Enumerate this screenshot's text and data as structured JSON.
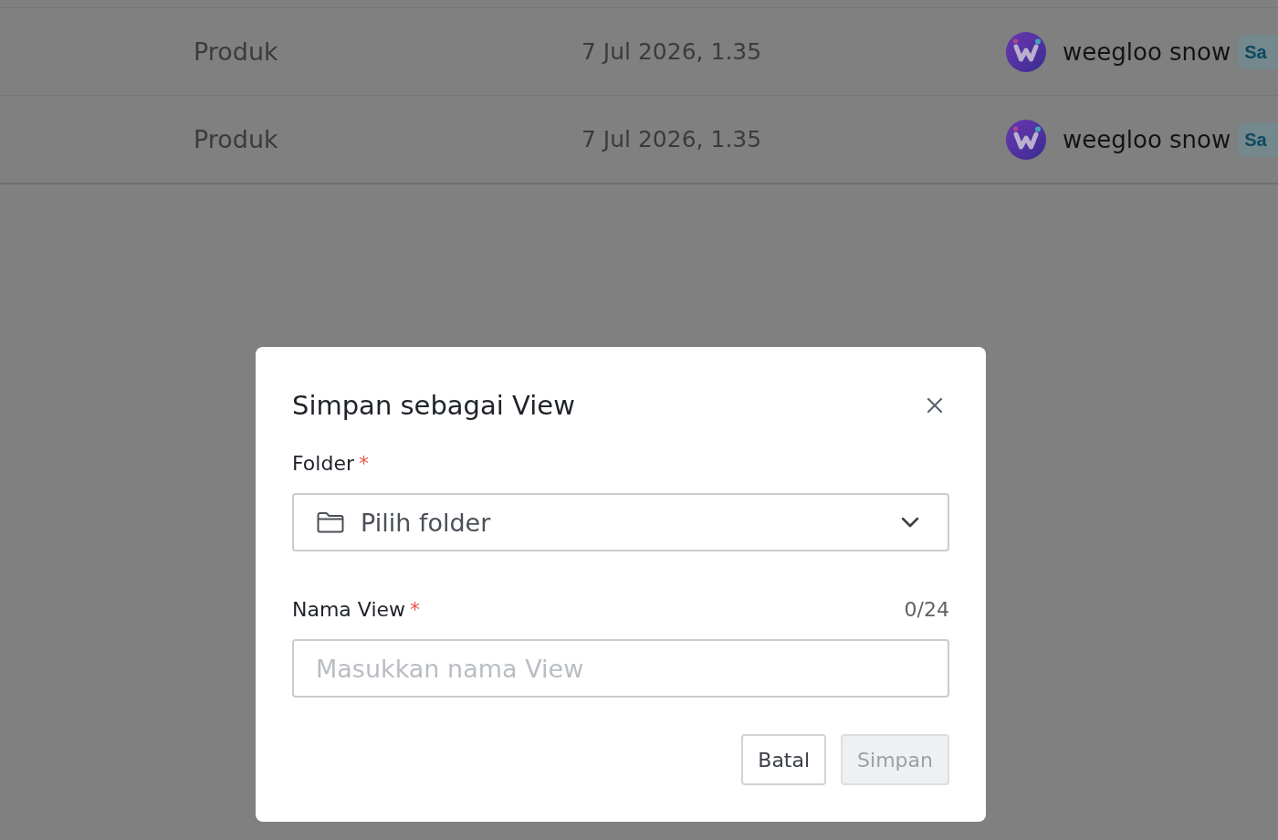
{
  "table": {
    "rows": [
      {
        "column_1": "Produk",
        "column_2": "7 Jul 2026, 1.35",
        "column_3": "weegloo snow",
        "column_4": "Sa"
      },
      {
        "column_1": "Produk",
        "column_2": "7 Jul 2026, 1.35",
        "column_3": "weegloo snow",
        "column_4": "Sa"
      }
    ]
  },
  "dialog": {
    "title": "Simpan sebagai View",
    "fields": [
      {
        "kind": "select",
        "label": "Folder",
        "required_marker": "*",
        "placeholder": "Pilih folder"
      },
      {
        "kind": "text",
        "label": "Nama View",
        "required_marker": "*",
        "counter": "0/24",
        "placeholder": "Masukkan nama View"
      }
    ],
    "buttons": [
      {
        "kind": "secondary",
        "label": "Batal",
        "disabled": false
      },
      {
        "kind": "primary",
        "label": "Simpan",
        "disabled": true
      }
    ]
  }
}
